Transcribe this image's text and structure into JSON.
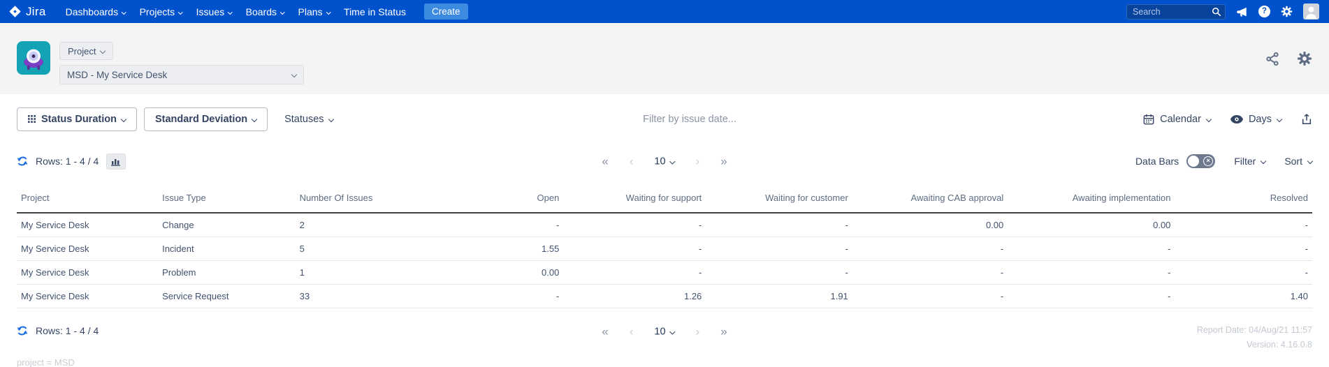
{
  "navbar": {
    "logo_text": "Jira",
    "items": [
      "Dashboards",
      "Projects",
      "Issues",
      "Boards",
      "Plans"
    ],
    "static_item": "Time in Status",
    "create_label": "Create",
    "search_placeholder": "Search"
  },
  "project_header": {
    "scope_label": "Project",
    "project_value": "MSD - My Service Desk"
  },
  "toolbar": {
    "report_label": "Status Duration",
    "calculation_label": "Standard Deviation",
    "statuses_label": "Statuses",
    "date_filter_placeholder": "Filter by issue date...",
    "calendar_label": "Calendar",
    "unit_label": "Days"
  },
  "list_controls": {
    "rows_label": "Rows: 1 - 4 / 4",
    "data_bars_label": "Data Bars",
    "filter_label": "Filter",
    "sort_label": "Sort"
  },
  "pagination": {
    "first": "«",
    "prev": "‹",
    "page_size": "10",
    "next": "›",
    "last": "»"
  },
  "table": {
    "columns": [
      "Project",
      "Issue Type",
      "Number Of Issues",
      "Open",
      "Waiting for support",
      "Waiting for customer",
      "Awaiting CAB approval",
      "Awaiting implementation",
      "Resolved"
    ],
    "rows": [
      [
        "My Service Desk",
        "Change",
        "2",
        "-",
        "-",
        "-",
        "0.00",
        "0.00",
        "-"
      ],
      [
        "My Service Desk",
        "Incident",
        "5",
        "1.55",
        "-",
        "-",
        "-",
        "-",
        "-"
      ],
      [
        "My Service Desk",
        "Problem",
        "1",
        "0.00",
        "-",
        "-",
        "-",
        "-",
        "-"
      ],
      [
        "My Service Desk",
        "Service Request",
        "33",
        "-",
        "1.26",
        "1.91",
        "-",
        "-",
        "1.40"
      ]
    ]
  },
  "footer": {
    "rows_label": "Rows: 1 - 4 / 4",
    "report_date": "Report Date: 04/Aug/21 11:57",
    "version": "Version: 4.16.0.8",
    "query_text": "project = MSD"
  },
  "colors": {
    "navbar_bg": "#0052cc",
    "create_button_bg": "#3d8be0",
    "refresh_blue": "#1d6fe0",
    "text_navy": "#344563",
    "table_header_gray": "#5e6c84",
    "muted_light_gray": "#c3c9d2",
    "avatar_teal": "#13a3b5",
    "avatar_purple": "#7b3fc4"
  }
}
